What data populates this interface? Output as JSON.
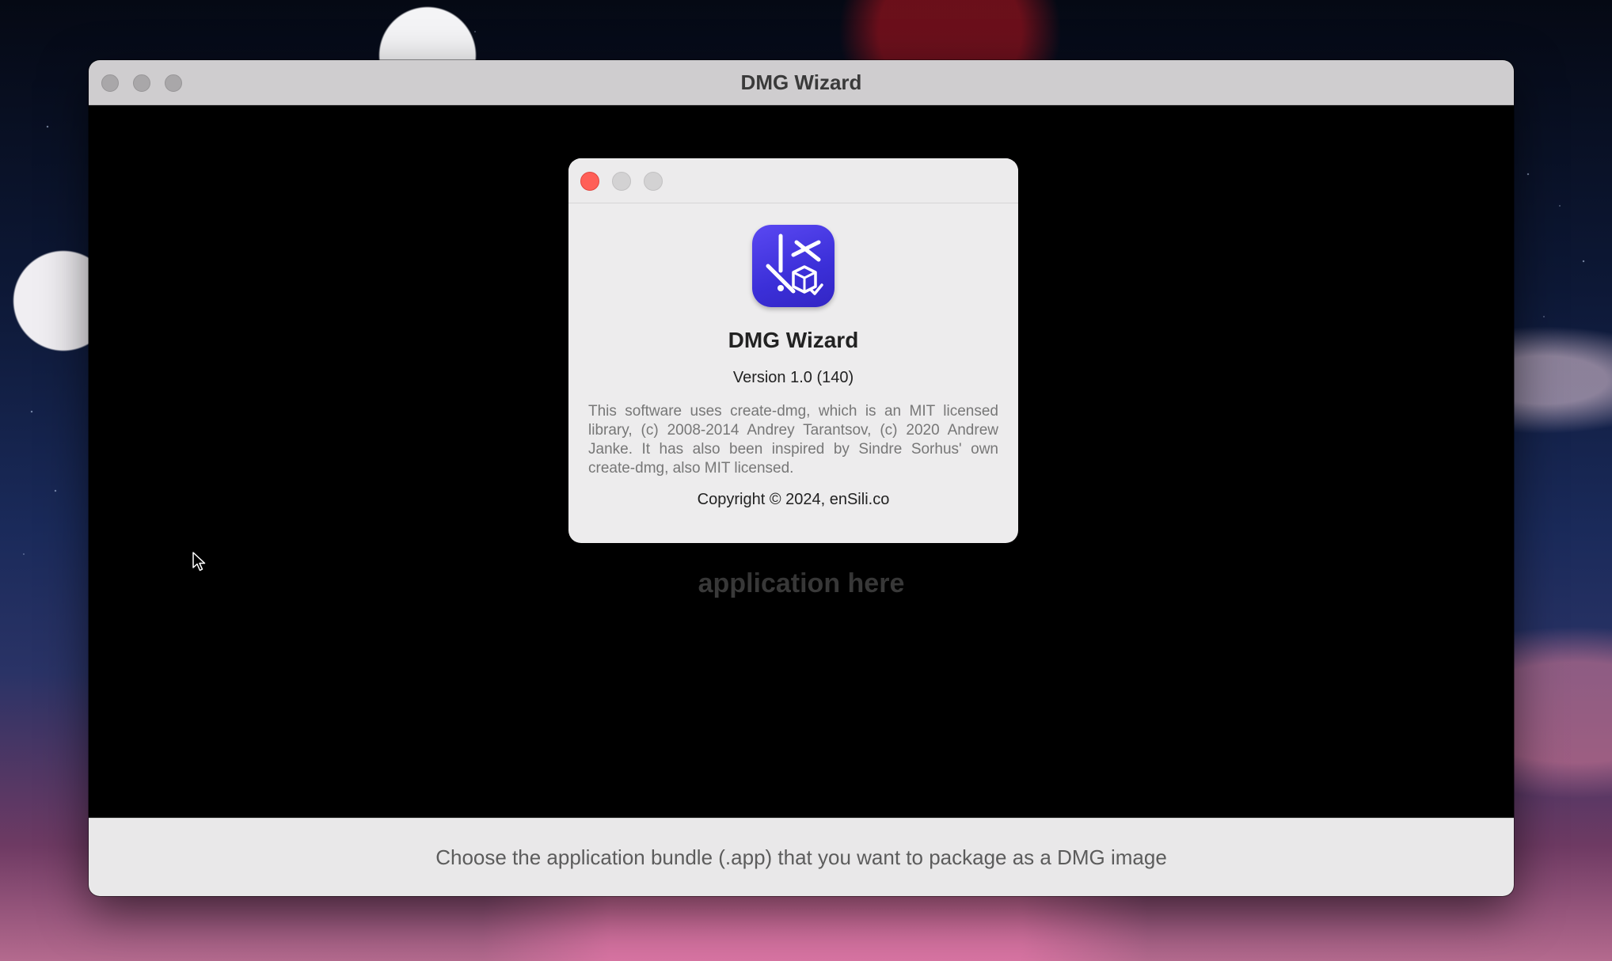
{
  "main_window": {
    "title": "DMG Wizard",
    "drop_hint": "application here",
    "footer_text": "Choose the application bundle (.app) that you want to package as a DMG image"
  },
  "about_dialog": {
    "app_name": "DMG Wizard",
    "version": "Version 1.0 (140)",
    "credits": "This software uses create-dmg, which is an MIT licensed library,  (c) 2008-2014 Andrey Tarantsov, (c) 2020 Andrew Janke. It has also been inspired by Sindre Sorhus' own create-dmg, also MIT licensed.",
    "copyright": "Copyright © 2024, enSili.co",
    "icon": "dmg-wizard-app-icon"
  },
  "colors": {
    "close_red": "#ff5f57",
    "icon_purple": "#4a3be6",
    "content_bg": "#000000"
  }
}
